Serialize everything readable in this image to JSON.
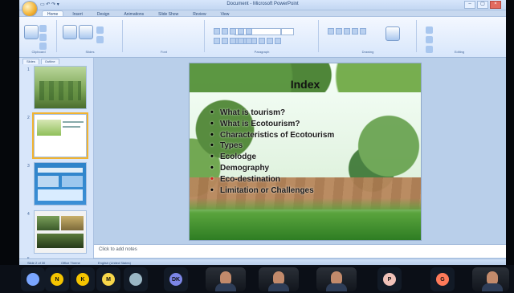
{
  "window": {
    "title": "Document - Microsoft PowerPoint"
  },
  "ribbon": {
    "tabs": [
      "Home",
      "Insert",
      "Design",
      "Animations",
      "Slide Show",
      "Review",
      "View"
    ],
    "groups": [
      {
        "label": "Clipboard"
      },
      {
        "label": "Slides"
      },
      {
        "label": "Font"
      },
      {
        "label": "Paragraph"
      },
      {
        "label": "Drawing"
      },
      {
        "label": "Editing"
      }
    ]
  },
  "sidebar": {
    "tabs": [
      "Slides",
      "Outline"
    ],
    "slide_numbers": [
      "1",
      "2",
      "3",
      "4",
      "5"
    ]
  },
  "slide": {
    "title": "Index",
    "bullets": [
      {
        "text": "What is tourism?",
        "bullet_color": "#000000"
      },
      {
        "text": "What is Ecotourism?",
        "bullet_color": "#000000"
      },
      {
        "text": "Characteristics of Ecotourism",
        "bullet_color": "#000000"
      },
      {
        "text": "Types",
        "bullet_color": "#000000"
      },
      {
        "text": "Ecolodge",
        "bullet_color": "#000000"
      },
      {
        "text": "Demography",
        "bullet_color": "#000000"
      },
      {
        "text": "Eco-destination",
        "bullet_color": "#d31f1f"
      },
      {
        "text": "Limitation or Challenges",
        "bullet_color": "#000000"
      }
    ]
  },
  "notes": {
    "placeholder": "Click to add notes"
  },
  "statusbar": {
    "slide_info": "Slide 2 of 30",
    "theme": "Office Theme",
    "language": "English (United States)"
  },
  "meeting": {
    "participants": [
      {
        "initial": "",
        "color": "#7aa6ff"
      },
      {
        "initial": "N",
        "color": "#f4c400"
      },
      {
        "initial": "K",
        "color": "#f4c400"
      },
      {
        "initial": "M",
        "color": "#f7d64a"
      },
      {
        "initial": "",
        "color": "#9bb7c5"
      },
      {
        "initial": "DK",
        "color": "#7c86e6"
      },
      {
        "initial": "",
        "color": "#c28a6b"
      },
      {
        "initial": "",
        "color": "#c28a6b"
      },
      {
        "initial": "",
        "color": "#c28a6b"
      },
      {
        "initial": "P",
        "color": "#f0c2b9"
      },
      {
        "initial": "G",
        "color": "#ff7a59"
      },
      {
        "initial": "",
        "color": "#c28a6b"
      }
    ]
  }
}
